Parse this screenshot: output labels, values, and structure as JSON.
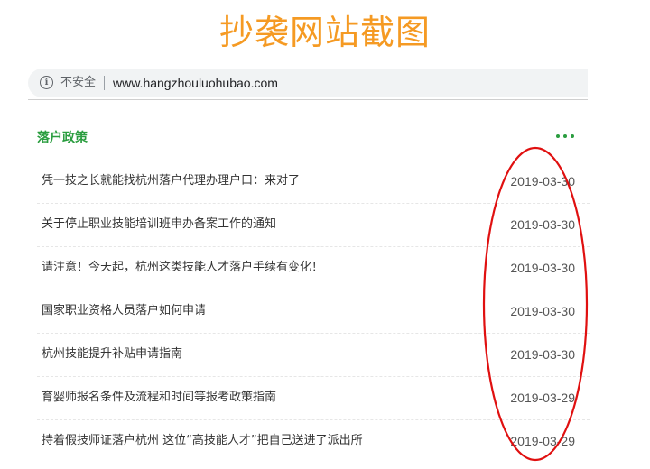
{
  "page_title": "抄袭网站截图",
  "address_bar": {
    "security_label": "不安全",
    "url": "www.hangzhouluohubao.com"
  },
  "section": {
    "title": "落户政策",
    "more_icon": "more-dots-icon"
  },
  "news": [
    {
      "title": "凭一技之长就能找杭州落户代理办理户口：来对了",
      "date": "2019-03-30"
    },
    {
      "title": "关于停止职业技能培训班申办备案工作的通知",
      "date": "2019-03-30"
    },
    {
      "title": "请注意！今天起，杭州这类技能人才落户手续有变化！",
      "date": "2019-03-30"
    },
    {
      "title": "国家职业资格人员落户如何申请",
      "date": "2019-03-30"
    },
    {
      "title": "杭州技能提升补贴申请指南",
      "date": "2019-03-30"
    },
    {
      "title": "育婴师报名条件及流程和时间等报考政策指南",
      "date": "2019-03-29"
    },
    {
      "title": "持着假技师证落户杭州 这位“高技能人才”把自己送进了派出所",
      "date": "2019-03-29"
    }
  ],
  "colors": {
    "title_orange": "#f59a23",
    "section_green": "#2a9d3f",
    "annotation_red": "#e01010"
  }
}
